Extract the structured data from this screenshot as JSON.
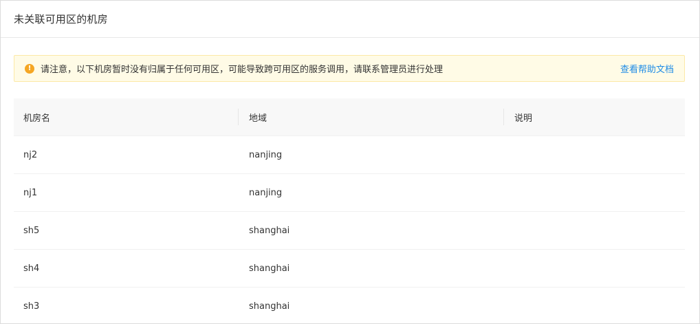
{
  "panel": {
    "title": "未关联可用区的机房"
  },
  "notice": {
    "icon": "warning-circle-icon",
    "icon_glyph": "!",
    "text": "请注意，以下机房暂时没有归属于任何可用区，可能导致跨可用区的服务调用，请联系管理员进行处理",
    "link_label": "查看帮助文档",
    "colors": {
      "background": "#fffbe6",
      "border": "#fce9a6",
      "icon": "#f5a623",
      "link": "#1f8ce6"
    }
  },
  "table": {
    "headers": [
      "机房名",
      "地域",
      "说明"
    ],
    "rows": [
      {
        "name": "nj2",
        "region": "nanjing",
        "desc": ""
      },
      {
        "name": "nj1",
        "region": "nanjing",
        "desc": ""
      },
      {
        "name": "sh5",
        "region": "shanghai",
        "desc": ""
      },
      {
        "name": "sh4",
        "region": "shanghai",
        "desc": ""
      },
      {
        "name": "sh3",
        "region": "shanghai",
        "desc": ""
      }
    ]
  }
}
